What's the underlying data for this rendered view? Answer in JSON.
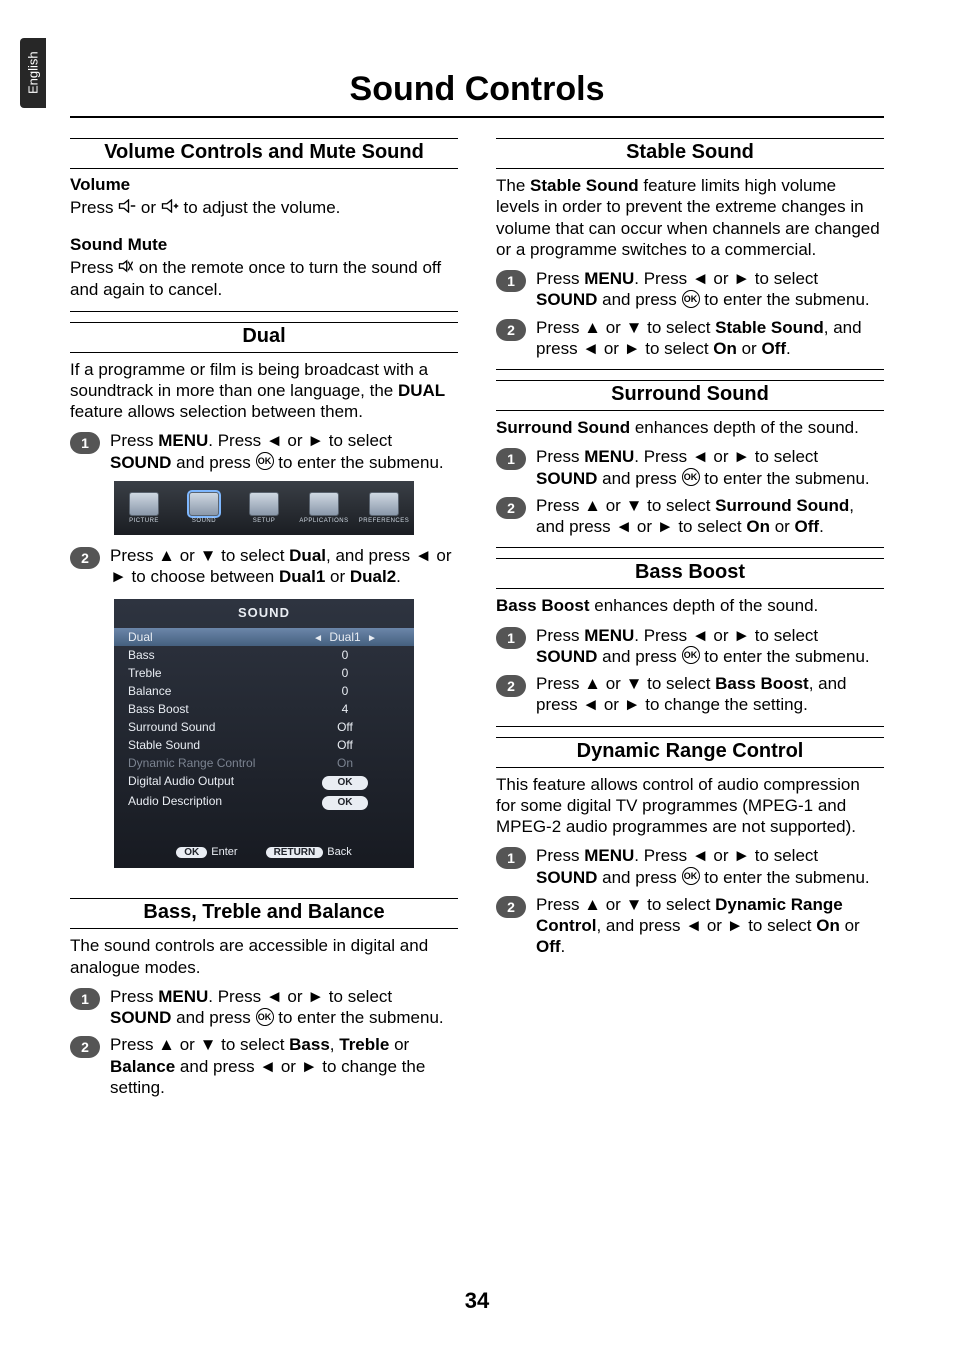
{
  "lang_tab": "English",
  "page_title": "Sound Controls",
  "page_number": "34",
  "glyph": {
    "left": "◄",
    "right": "►",
    "up": "▲",
    "down": "▼",
    "ok": "OK"
  },
  "left": {
    "volume_section": {
      "heading": "Volume Controls and Mute Sound",
      "volume_label": "Volume",
      "volume_text_a": "Press ",
      "volume_text_b": " or ",
      "volume_text_c": " to adjust the volume.",
      "mute_label": "Sound Mute",
      "mute_text_a": "Press ",
      "mute_text_b": " on the remote once to turn the sound off and again to cancel."
    },
    "dual_section": {
      "heading": "Dual",
      "intro_a": "If a programme or film is being broadcast with a soundtrack in more than one language, the ",
      "intro_bold": "DUAL",
      "intro_b": " feature allows selection between them.",
      "step1_a": "Press ",
      "step1_menu": "MENU",
      "step1_b": ". Press ◄ or ► to select ",
      "step1_sound": "SOUND",
      "step1_c": " and press ",
      "step1_d": " to enter  the submenu.",
      "step2_a": "Press ▲ or ▼ to select ",
      "step2_dual": "Dual",
      "step2_b": ", and press ◄ or ► to choose between ",
      "step2_dual1": "Dual1",
      "step2_or": " or ",
      "step2_dual2": "Dual2",
      "step2_c": "."
    },
    "menubar": {
      "items": [
        {
          "label": "PICTURE"
        },
        {
          "label": "SOUND"
        },
        {
          "label": "SETUP"
        },
        {
          "label": "APPLICATIONS"
        },
        {
          "label": "PREFERENCES"
        }
      ]
    },
    "osd": {
      "title": "SOUND",
      "rows": [
        {
          "label": "Dual",
          "value": "Dual1",
          "highlight": true,
          "arrows": true
        },
        {
          "label": "Bass",
          "value": "0"
        },
        {
          "label": "Treble",
          "value": "0"
        },
        {
          "label": "Balance",
          "value": "0"
        },
        {
          "label": "Bass Boost",
          "value": "4"
        },
        {
          "label": "Surround Sound",
          "value": "Off"
        },
        {
          "label": "Stable Sound",
          "value": "Off"
        },
        {
          "label": "Dynamic Range Control",
          "value": "On",
          "dim": true
        },
        {
          "label": "Digital Audio Output",
          "value": "OK",
          "pill": true
        },
        {
          "label": "Audio Description",
          "value": "OK",
          "pill": true
        }
      ],
      "footer_ok": "OK",
      "footer_enter": "Enter",
      "footer_return": "RETURN",
      "footer_back": "Back"
    },
    "btb_section": {
      "heading": "Bass, Treble and Balance",
      "intro": "The sound controls are accessible in digital and analogue modes.",
      "step1_a": "Press ",
      "step1_menu": "MENU",
      "step1_b": ". Press ◄ or ► to select ",
      "step1_sound": "SOUND",
      "step1_c": " and press ",
      "step1_d": " to enter  the submenu.",
      "step2_a": "Press ▲ or ▼ to select ",
      "step2_bass": "Bass",
      "step2_s1": ", ",
      "step2_treble": "Treble",
      "step2_s2": " or ",
      "step2_balance": "Balance",
      "step2_b": " and press ◄ or ► to change the setting."
    }
  },
  "right": {
    "stable": {
      "heading": "Stable Sound",
      "intro_a": "The ",
      "intro_bold": "Stable Sound",
      "intro_b": " feature limits high volume levels in order to prevent the extreme changes in volume that can occur when channels are changed or a programme switches to a commercial.",
      "step1_a": "Press ",
      "step1_menu": "MENU",
      "step1_b": ". Press ◄ or ► to select ",
      "step1_sound": "SOUND",
      "step1_c": " and press ",
      "step1_d": " to enter  the submenu.",
      "step2_a": "Press ▲ or ▼ to select ",
      "step2_bold": "Stable Sound",
      "step2_b": ", and press ◄ or ► to select ",
      "step2_on": "On",
      "step2_or": " or ",
      "step2_off": "Off",
      "step2_c": "."
    },
    "surround": {
      "heading": "Surround Sound",
      "intro_bold": "Surround Sound",
      "intro_b": " enhances depth of the sound.",
      "step1_a": "Press ",
      "step1_menu": "MENU",
      "step1_b": ". Press ◄ or ► to select ",
      "step1_sound": "SOUND",
      "step1_c": " and press ",
      "step1_d": " to enter  the submenu.",
      "step2_a": "Press ▲ or ▼ to select ",
      "step2_bold": "Surround Sound",
      "step2_b": ", and press ◄ or ► to select ",
      "step2_on": "On",
      "step2_or": " or ",
      "step2_off": "Off",
      "step2_c": "."
    },
    "bassboost": {
      "heading": "Bass Boost",
      "intro_bold": "Bass Boost",
      "intro_b": " enhances depth of the sound.",
      "step1_a": "Press ",
      "step1_menu": "MENU",
      "step1_b": ". Press ◄ or ► to select ",
      "step1_sound": "SOUND",
      "step1_c": " and press ",
      "step1_d": " to enter  the submenu.",
      "step2_a": "Press ▲ or ▼ to select ",
      "step2_bold": "Bass Boost",
      "step2_b": ", and press ◄ or ► to change the setting."
    },
    "drc": {
      "heading": "Dynamic Range Control",
      "intro": "This feature allows control of audio compression for some digital TV programmes (MPEG-1 and MPEG-2 audio programmes are not supported).",
      "step1_a": "Press ",
      "step1_menu": "MENU",
      "step1_b": ". Press ◄ or ► to select ",
      "step1_sound": "SOUND",
      "step1_c": " and press ",
      "step1_d": " to enter  the submenu.",
      "step2_a": "Press ▲ or ▼ to select ",
      "step2_bold": "Dynamic Range Control",
      "step2_b": ", and press ◄ or ► to select ",
      "step2_on": "On",
      "step2_or": " or ",
      "step2_off": "Off",
      "step2_c": "."
    }
  }
}
